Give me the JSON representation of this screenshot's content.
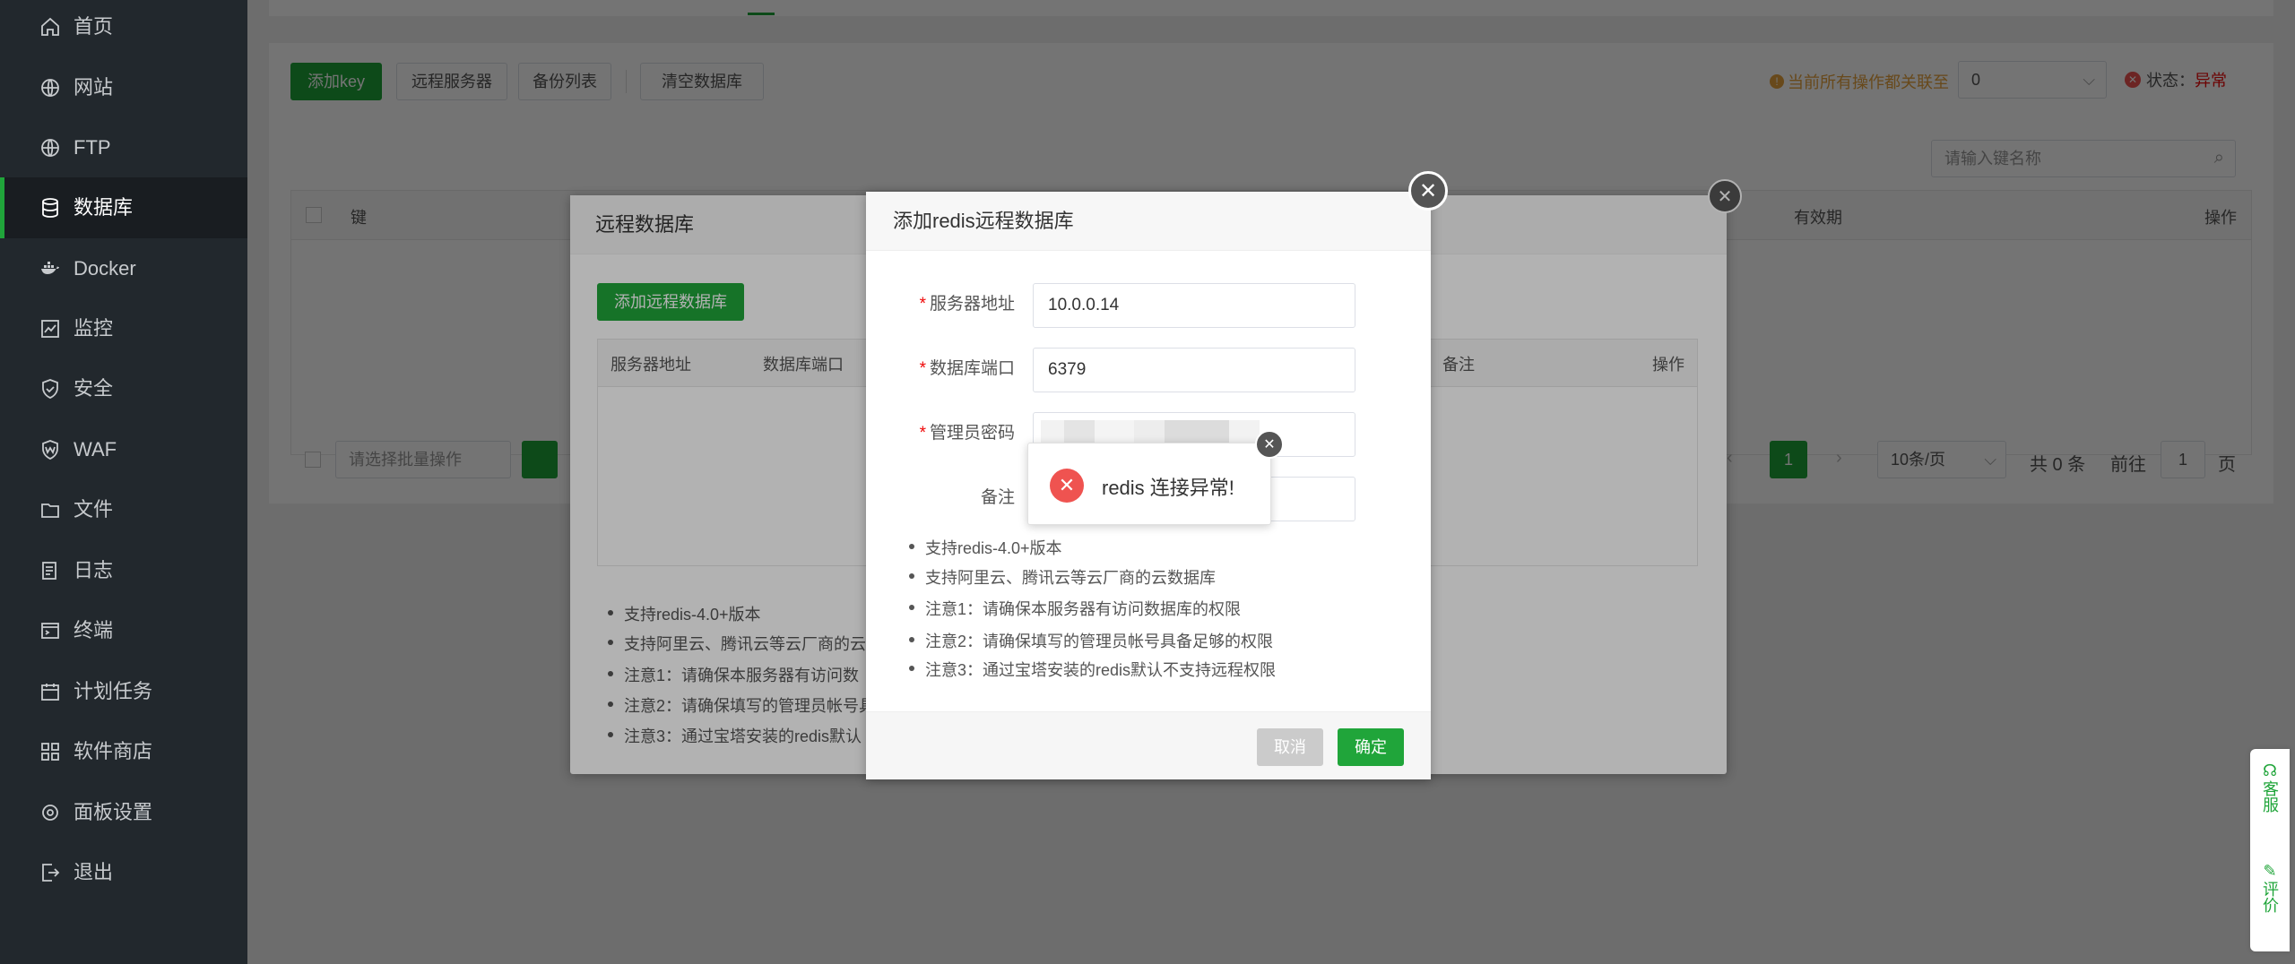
{
  "sidebar": {
    "items": [
      {
        "label": "首页",
        "icon": "home-icon"
      },
      {
        "label": "网站",
        "icon": "globe-icon"
      },
      {
        "label": "FTP",
        "icon": "ftp-globe-icon"
      },
      {
        "label": "数据库",
        "icon": "database-icon"
      },
      {
        "label": "Docker",
        "icon": "docker-icon"
      },
      {
        "label": "监控",
        "icon": "monitor-icon"
      },
      {
        "label": "安全",
        "icon": "shield-icon"
      },
      {
        "label": "WAF",
        "icon": "waf-shield-icon"
      },
      {
        "label": "文件",
        "icon": "folder-icon"
      },
      {
        "label": "日志",
        "icon": "log-icon"
      },
      {
        "label": "终端",
        "icon": "terminal-icon"
      },
      {
        "label": "计划任务",
        "icon": "calendar-icon"
      },
      {
        "label": "软件商店",
        "icon": "grid-icon"
      },
      {
        "label": "面板设置",
        "icon": "gear-icon"
      },
      {
        "label": "退出",
        "icon": "logout-icon"
      }
    ],
    "active_index": 3,
    "active_color": "#20a53a"
  },
  "toolbar": {
    "add_key": "添加key",
    "remote_server": "远程服务器",
    "backup_list": "备份列表",
    "clear_db": "清空数据库",
    "warning": "当前所有操作都关联至",
    "db_select": "0",
    "status_label": "状态：",
    "status_value": "异常"
  },
  "search": {
    "placeholder": "请输入键名称"
  },
  "table": {
    "col_key": "键",
    "col_ttl": "有效期",
    "col_ops": "操作"
  },
  "pagination": {
    "batch_placeholder": "请选择批量操作",
    "page": "1",
    "page_size": "10条/页",
    "total": "共 0 条",
    "goto": "前往",
    "goto_page": "1",
    "page_unit": "页"
  },
  "remote_dialog": {
    "title": "远程数据库",
    "add_button": "添加远程数据库",
    "cols": [
      "服务器地址",
      "数据库端口",
      "备注",
      "操作"
    ],
    "notes": [
      "支持redis-4.0+版本",
      "支持阿里云、腾讯云等云厂商的云",
      "注意1：请确保本服务器有访问数",
      "注意2：请确保填写的管理员帐号具",
      "注意3：通过宝塔安装的redis默认"
    ]
  },
  "add_dialog": {
    "title": "添加redis远程数据库",
    "fields": {
      "host_label": "服务器地址",
      "host_value": "10.0.0.14",
      "port_label": "数据库端口",
      "port_value": "6379",
      "pwd_label": "管理员密码",
      "remark_label": "备注"
    },
    "notes": [
      "支持redis-4.0+版本",
      "支持阿里云、腾讯云等云厂商的云数据库",
      "注意1：请确保本服务器有访问数据库的权限",
      "注意2：请确保填写的管理员帐号具备足够的权限",
      "注意3：通过宝塔安装的redis默认不支持远程权限"
    ],
    "cancel": "取消",
    "confirm": "确定"
  },
  "toast": {
    "message": "redis 连接异常!"
  },
  "service": {
    "support": "客服",
    "rate": "评价"
  },
  "colors": {
    "brand": "#20a53a",
    "error": "#ef5350",
    "sidebar_bg": "#22282d"
  }
}
